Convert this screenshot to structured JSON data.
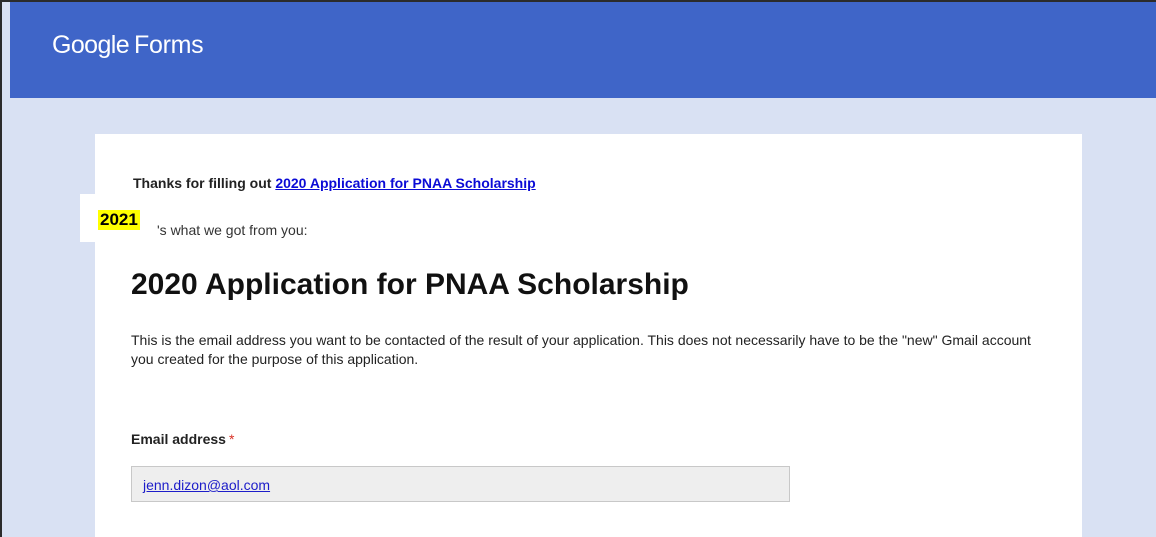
{
  "header": {
    "logo_brand": "Google",
    "logo_product": "Forms"
  },
  "message": {
    "thanks_prefix": "Thanks for filling out ",
    "form_link": "2020 Application for PNAA Scholarship",
    "got_text": "'s what we got from you:"
  },
  "overlay": {
    "year_badge": "2021",
    "badge_color": "#ffff00"
  },
  "form": {
    "title": "2020 Application for PNAA Scholarship",
    "description": "This is the email address you want to be contacted of the result of your application. This does not necessarily have to be the \"new\" Gmail account you created for the purpose of this application.",
    "fields": [
      {
        "label": "Email address",
        "required_marker": "*",
        "value": "jenn.dizon@aol.com"
      }
    ]
  },
  "colors": {
    "header_bg": "#3f65c8",
    "page_bg": "#d9e1f3",
    "link": "#1c1cc9"
  }
}
